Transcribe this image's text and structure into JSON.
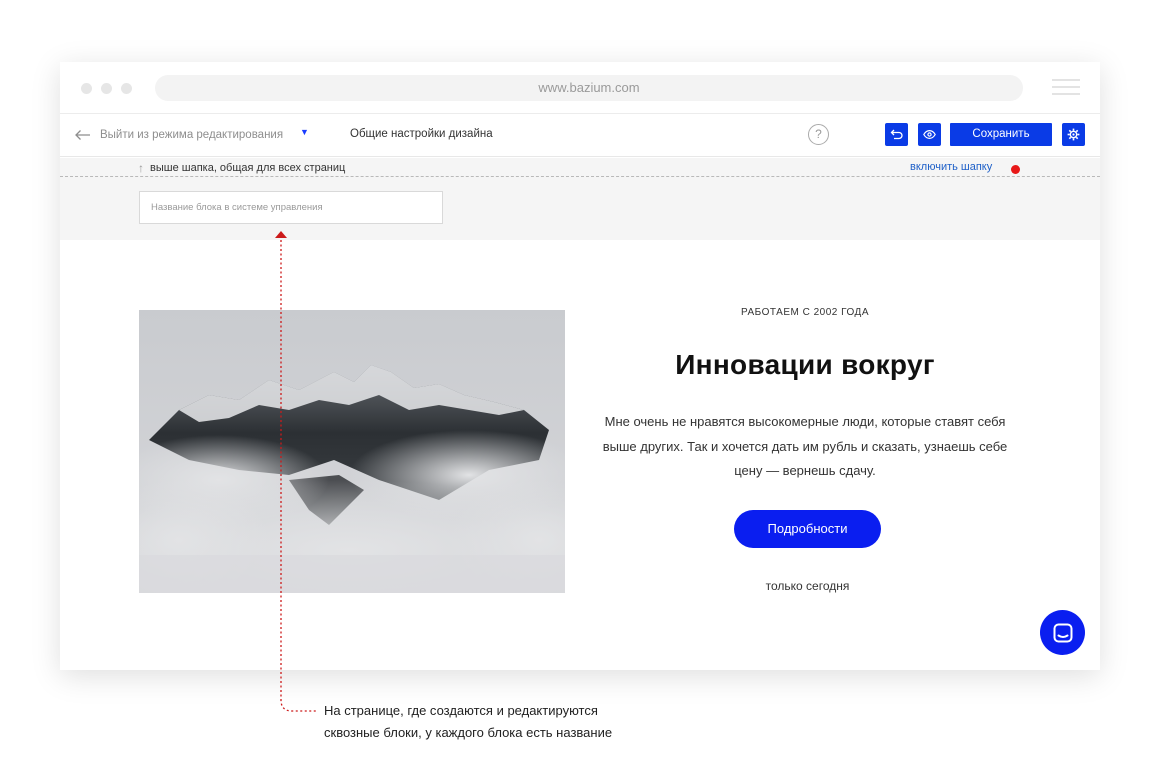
{
  "browser": {
    "url": "www.bazium.com"
  },
  "toolbar": {
    "exit_label": "Выйти из режима редактирования",
    "design_settings_label": "Общие настройки дизайна",
    "help_label": "?",
    "save_label": "Сохранить"
  },
  "header_zone": {
    "note": "выше шапка, общая для всех страниц",
    "enable_link": "включить шапку",
    "block_name_placeholder": "Название блока в системе управления"
  },
  "hero": {
    "eyebrow": "РАБОТАЕМ С 2002 ГОДА",
    "headline": "Инновации вокруг",
    "body": "Мне очень не нравятся высокомерные люди, которые ставят себя выше других. Так и хочется дать им рубль и сказать, узнаешь себе цену — вернешь сдачу.",
    "cta_label": "Подробности",
    "subnote": "только сегодня"
  },
  "annotation": {
    "line1": "На странице, где создаются и редактируются",
    "line2": "сквозные блоки, у каждого блока есть название"
  },
  "colors": {
    "accent": "#0a3be6",
    "cta": "#0a1ef0",
    "indicator": "#e81818",
    "link": "#1d5fc8"
  },
  "icons": {
    "back": "arrow-left-icon",
    "dropdown": "caret-down-icon",
    "help": "question-icon",
    "undo": "undo-icon",
    "preview": "eye-icon",
    "settings": "gear-icon",
    "chat": "chat-icon",
    "up": "arrow-up-icon"
  }
}
